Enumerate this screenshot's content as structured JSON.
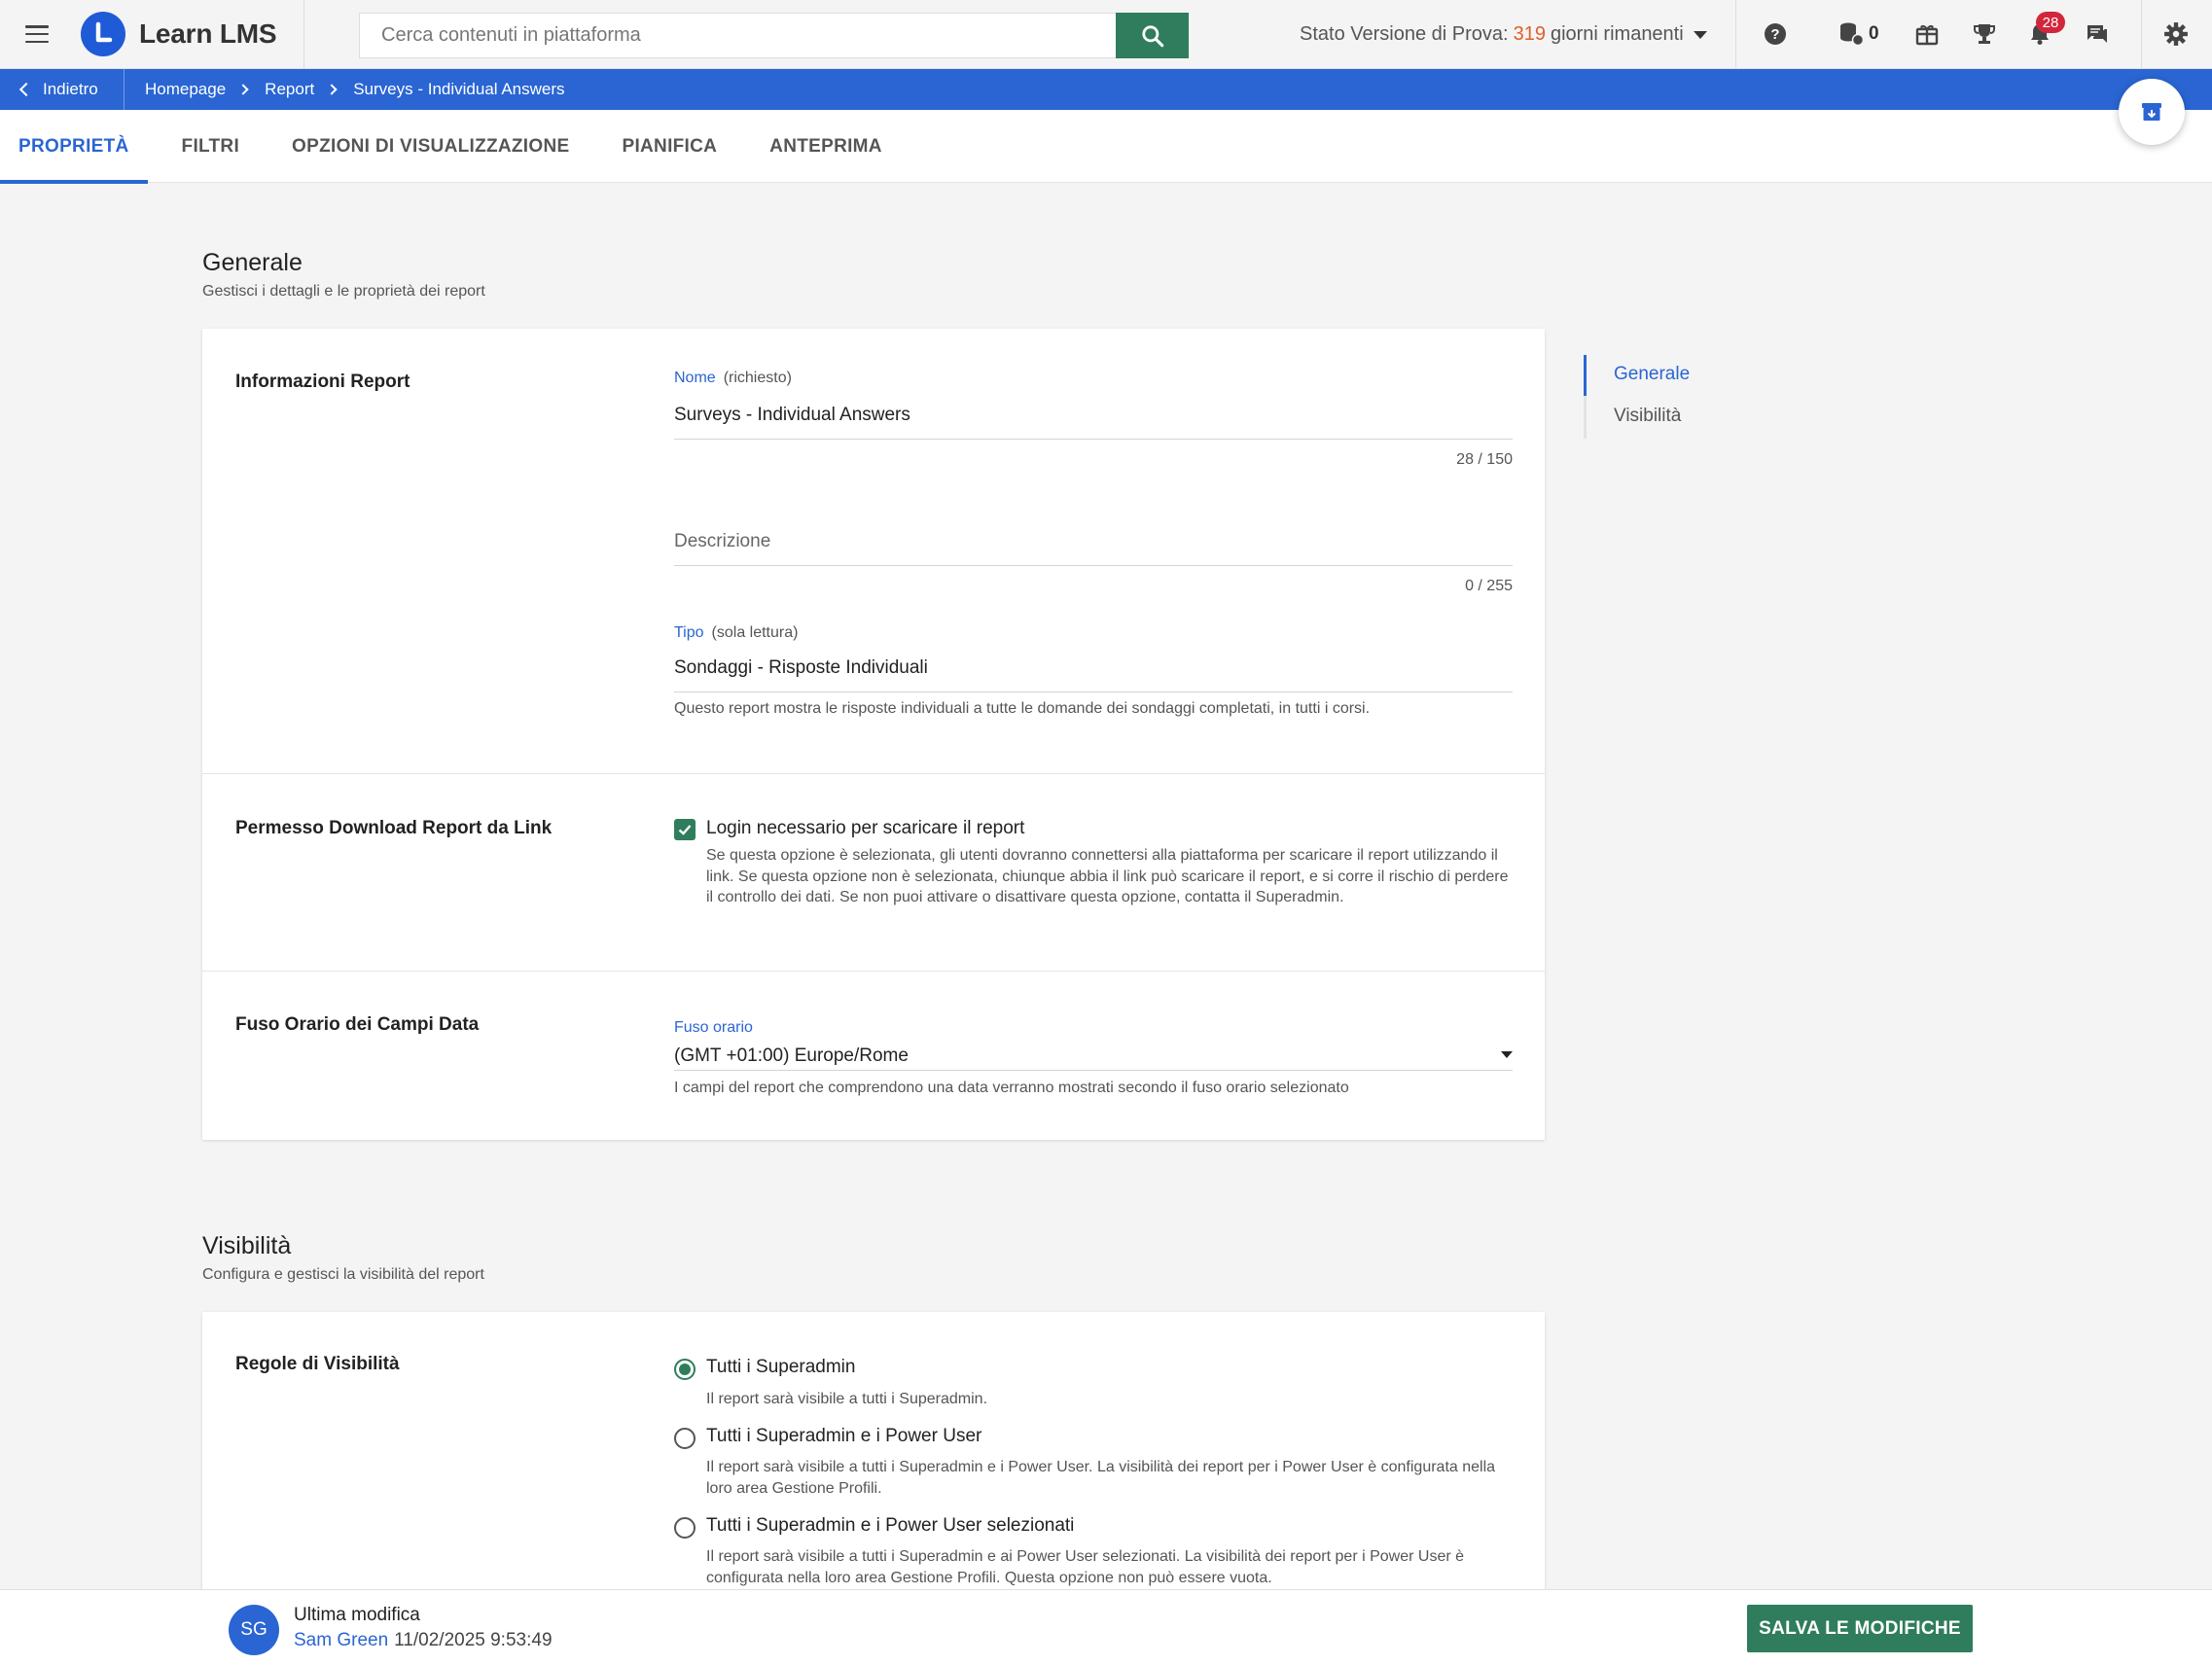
{
  "app": {
    "name": "Learn LMS"
  },
  "search": {
    "placeholder": "Cerca contenuti in piattaforma"
  },
  "trial": {
    "prefix": "Stato Versione di Prova:",
    "days": "319",
    "suffix": "giorni rimanenti"
  },
  "topbar": {
    "coins": "0",
    "notifications": "28"
  },
  "breadcrumb": {
    "back": "Indietro",
    "items": [
      "Homepage",
      "Report",
      "Surveys - Individual Answers"
    ]
  },
  "tabs": [
    "PROPRIETÀ",
    "FILTRI",
    "OPZIONI DI VISUALIZZAZIONE",
    "PIANIFICA",
    "ANTEPRIMA"
  ],
  "general": {
    "title": "Generale",
    "subtitle": "Gestisci i dettagli e le proprietà dei report",
    "info_label": "Informazioni Report",
    "name_label": "Nome",
    "name_hint": "(richiesto)",
    "name_value": "Surveys - Individual Answers",
    "name_counter": "28 / 150",
    "desc_placeholder": "Descrizione",
    "desc_counter": "0 / 255",
    "type_label": "Tipo",
    "type_hint": "(sola lettura)",
    "type_value": "Sondaggi - Risposte Individuali",
    "type_help": "Questo report mostra le risposte individuali a tutte le domande dei sondaggi completati, in tutti i corsi.",
    "download_label": "Permesso Download Report da Link",
    "download_option": "Login necessario per scaricare il report",
    "download_checked": true,
    "download_desc": "Se questa opzione è selezionata, gli utenti dovranno connettersi alla piattaforma per scaricare il report utilizzando il link. Se questa opzione non è selezionata, chiunque abbia il link può scaricare il report, e si corre il rischio di perdere il controllo dei dati. Se non puoi attivare o disattivare questa opzione, contatta il Superadmin.",
    "timezone_row_label": "Fuso Orario dei Campi Data",
    "timezone_label": "Fuso orario",
    "timezone_value": "(GMT +01:00) Europe/Rome",
    "timezone_help": "I campi del report che comprendono una data verranno mostrati secondo il fuso orario selezionato"
  },
  "visibility": {
    "title": "Visibilità",
    "subtitle": "Configura e gestisci la visibilità del report",
    "rules_label": "Regole di Visibilità",
    "options": [
      {
        "label": "Tutti i Superadmin",
        "desc": "Il report sarà visibile a tutti i Superadmin.",
        "selected": true
      },
      {
        "label": "Tutti i Superadmin e i Power User",
        "desc": "Il report sarà visibile a tutti i Superadmin e i Power User. La visibilità dei report per i Power User è configurata nella loro area Gestione Profili.",
        "selected": false
      },
      {
        "label": "Tutti i Superadmin e i Power User selezionati",
        "desc": "Il report sarà visibile a tutti i Superadmin e ai Power User selezionati. La visibilità dei report per i Power User è configurata nella loro area Gestione Profili. Questa opzione non può essere vuota.",
        "selected": false
      }
    ]
  },
  "side_nav": [
    "Generale",
    "Visibilità"
  ],
  "footer": {
    "avatar": "SG",
    "title": "Ultima modifica",
    "user": "Sam Green",
    "timestamp": "11/02/2025 9:53:49",
    "save": "SALVA LE MODIFICHE"
  },
  "colors": {
    "brand_blue": "#2a65d3",
    "accent_green": "#2f7d5c",
    "trial_orange": "#e0602a",
    "badge_red": "#d2263b"
  },
  "icons": [
    "menu-icon",
    "logo-icon",
    "search-icon",
    "help-icon",
    "coins-icon",
    "gift-icon",
    "trophy-icon",
    "bell-icon",
    "chat-icon",
    "gear-icon",
    "chevron-left-icon",
    "chevron-right-icon",
    "archive-icon",
    "check-icon",
    "caret-down-icon"
  ]
}
